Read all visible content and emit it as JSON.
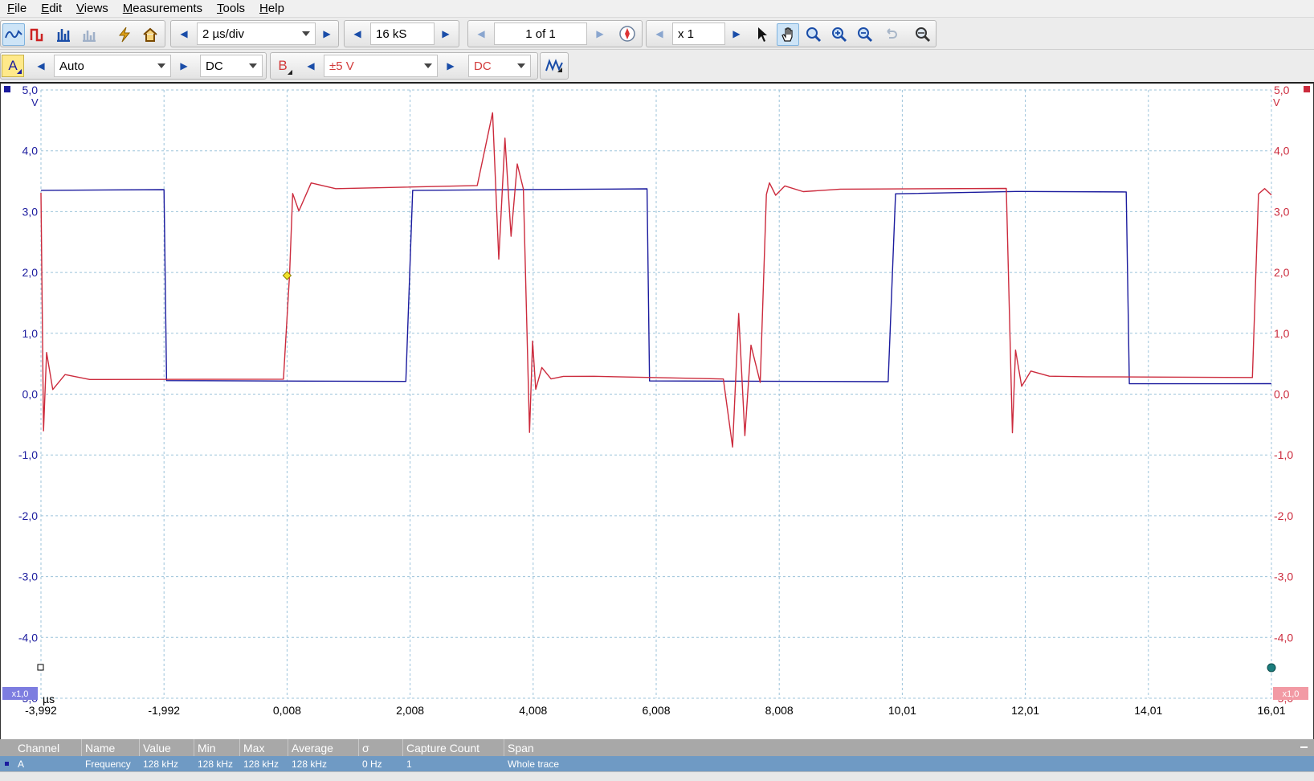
{
  "menu": {
    "items": [
      {
        "label": "File",
        "u": "F",
        "rest": "ile"
      },
      {
        "label": "Edit",
        "u": "E",
        "rest": "dit"
      },
      {
        "label": "Views",
        "u": "V",
        "rest": "iews"
      },
      {
        "label": "Measurements",
        "u": "M",
        "rest": "easurements"
      },
      {
        "label": "Tools",
        "u": "T",
        "rest": "ools"
      },
      {
        "label": "Help",
        "u": "H",
        "rest": "elp"
      }
    ]
  },
  "toolbar": {
    "timebase": "2 µs/div",
    "samples": "16 kS",
    "buffer": "1 of 1",
    "zoom": "x 1"
  },
  "channelA": {
    "label": "A",
    "range": "Auto",
    "coupling": "DC",
    "color": "#1b1b9e"
  },
  "channelB": {
    "label": "B",
    "range": "±5 V",
    "coupling": "DC",
    "color": "#cc2b3d"
  },
  "plot": {
    "unit_left": "V",
    "unit_right": "V",
    "x_unit": "µs",
    "scale_left": "x1,0",
    "scale_right": "x1,0",
    "y_ticks": [
      "5,0",
      "4,0",
      "3,0",
      "2,0",
      "1,0",
      "0,0",
      "-1,0",
      "-2,0",
      "-3,0",
      "-4,0",
      "-5,0"
    ],
    "x_ticks": [
      "-3,992",
      "-1,992",
      "0,008",
      "2,008",
      "4,008",
      "6,008",
      "8,008",
      "10,01",
      "12,01",
      "14,01",
      "16,01"
    ]
  },
  "chart_data": {
    "type": "line",
    "xlim": [
      -3.992,
      16.01
    ],
    "ylim": [
      -5,
      5
    ],
    "grid": true,
    "series": [
      {
        "channel": "A",
        "color": "#1b1b9e",
        "x": [
          -3.992,
          -1.992,
          -1.95,
          1.94,
          2.05,
          5.86,
          5.9,
          9.78,
          9.9,
          11.86,
          13.65,
          13.7,
          16.01
        ],
        "y": [
          3.35,
          3.35,
          0.2,
          0.18,
          3.32,
          3.35,
          0.2,
          0.2,
          3.3,
          3.35,
          3.35,
          0.2,
          0.2
        ]
      },
      {
        "channel": "B",
        "color": "#cc2b3d",
        "x": [
          -3.992,
          -3.95,
          -3.9,
          -3.8,
          -3.6,
          -3.2,
          -0.05,
          0.05,
          0.1,
          0.2,
          0.4,
          0.8,
          3.1,
          3.35,
          3.45,
          3.55,
          3.65,
          3.75,
          3.85,
          3.95,
          4.0,
          4.05,
          4.15,
          4.3,
          4.5,
          5.0,
          7.1,
          7.25,
          7.35,
          7.45,
          7.55,
          7.7,
          7.8,
          7.85,
          7.95,
          8.1,
          8.4,
          9.0,
          11.7,
          11.8,
          11.85,
          11.95,
          12.1,
          12.4,
          13.0,
          15.7,
          15.8,
          15.9,
          16.01
        ],
        "y": [
          3.3,
          -0.6,
          0.7,
          0.1,
          0.35,
          0.27,
          0.27,
          2.0,
          3.3,
          3.0,
          3.45,
          3.35,
          3.4,
          4.6,
          2.2,
          4.2,
          2.6,
          3.8,
          3.4,
          -0.6,
          0.9,
          0.1,
          0.45,
          0.25,
          0.28,
          0.27,
          0.22,
          -0.9,
          1.3,
          -0.7,
          0.8,
          0.2,
          3.3,
          3.5,
          3.3,
          3.45,
          3.35,
          3.38,
          3.38,
          -0.65,
          0.7,
          0.1,
          0.35,
          0.27,
          0.27,
          0.27,
          3.3,
          3.4,
          3.3
        ]
      }
    ]
  },
  "measurements": {
    "headers": [
      "Channel",
      "Name",
      "Value",
      "Min",
      "Max",
      "Average",
      "σ",
      "Capture Count",
      "Span"
    ],
    "row": [
      "A",
      "Frequency",
      "128 kHz",
      "128 kHz",
      "128 kHz",
      "128 kHz",
      "0 Hz",
      "1",
      "Whole trace"
    ]
  }
}
